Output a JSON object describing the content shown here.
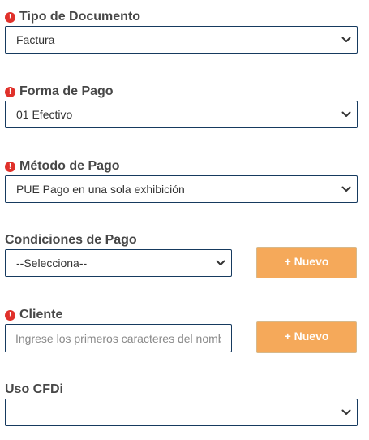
{
  "fields": {
    "tipo_documento": {
      "label": "Tipo de Documento",
      "required": true,
      "selected": "Factura"
    },
    "forma_pago": {
      "label": "Forma de Pago",
      "required": true,
      "selected": "01 Efectivo"
    },
    "metodo_pago": {
      "label": "Método de Pago",
      "required": true,
      "selected": "PUE Pago en una sola exhibición"
    },
    "condiciones_pago": {
      "label": "Condiciones de Pago",
      "required": false,
      "selected": "--Selecciona--",
      "button_label": "+ Nuevo"
    },
    "cliente": {
      "label": "Cliente",
      "required": true,
      "placeholder": "Ingrese los primeros caracteres del nombre",
      "value": "",
      "button_label": "+ Nuevo"
    },
    "uso_cfdi": {
      "label": "Uso CFDi",
      "required": false,
      "selected": ""
    }
  },
  "icons": {
    "required": "exclamation-circle-icon",
    "dropdown": "chevron-down-icon"
  },
  "colors": {
    "required_icon": "#e0312b",
    "input_border": "#163a5f",
    "button_bg": "#f5a95a",
    "label_text": "#474747"
  }
}
